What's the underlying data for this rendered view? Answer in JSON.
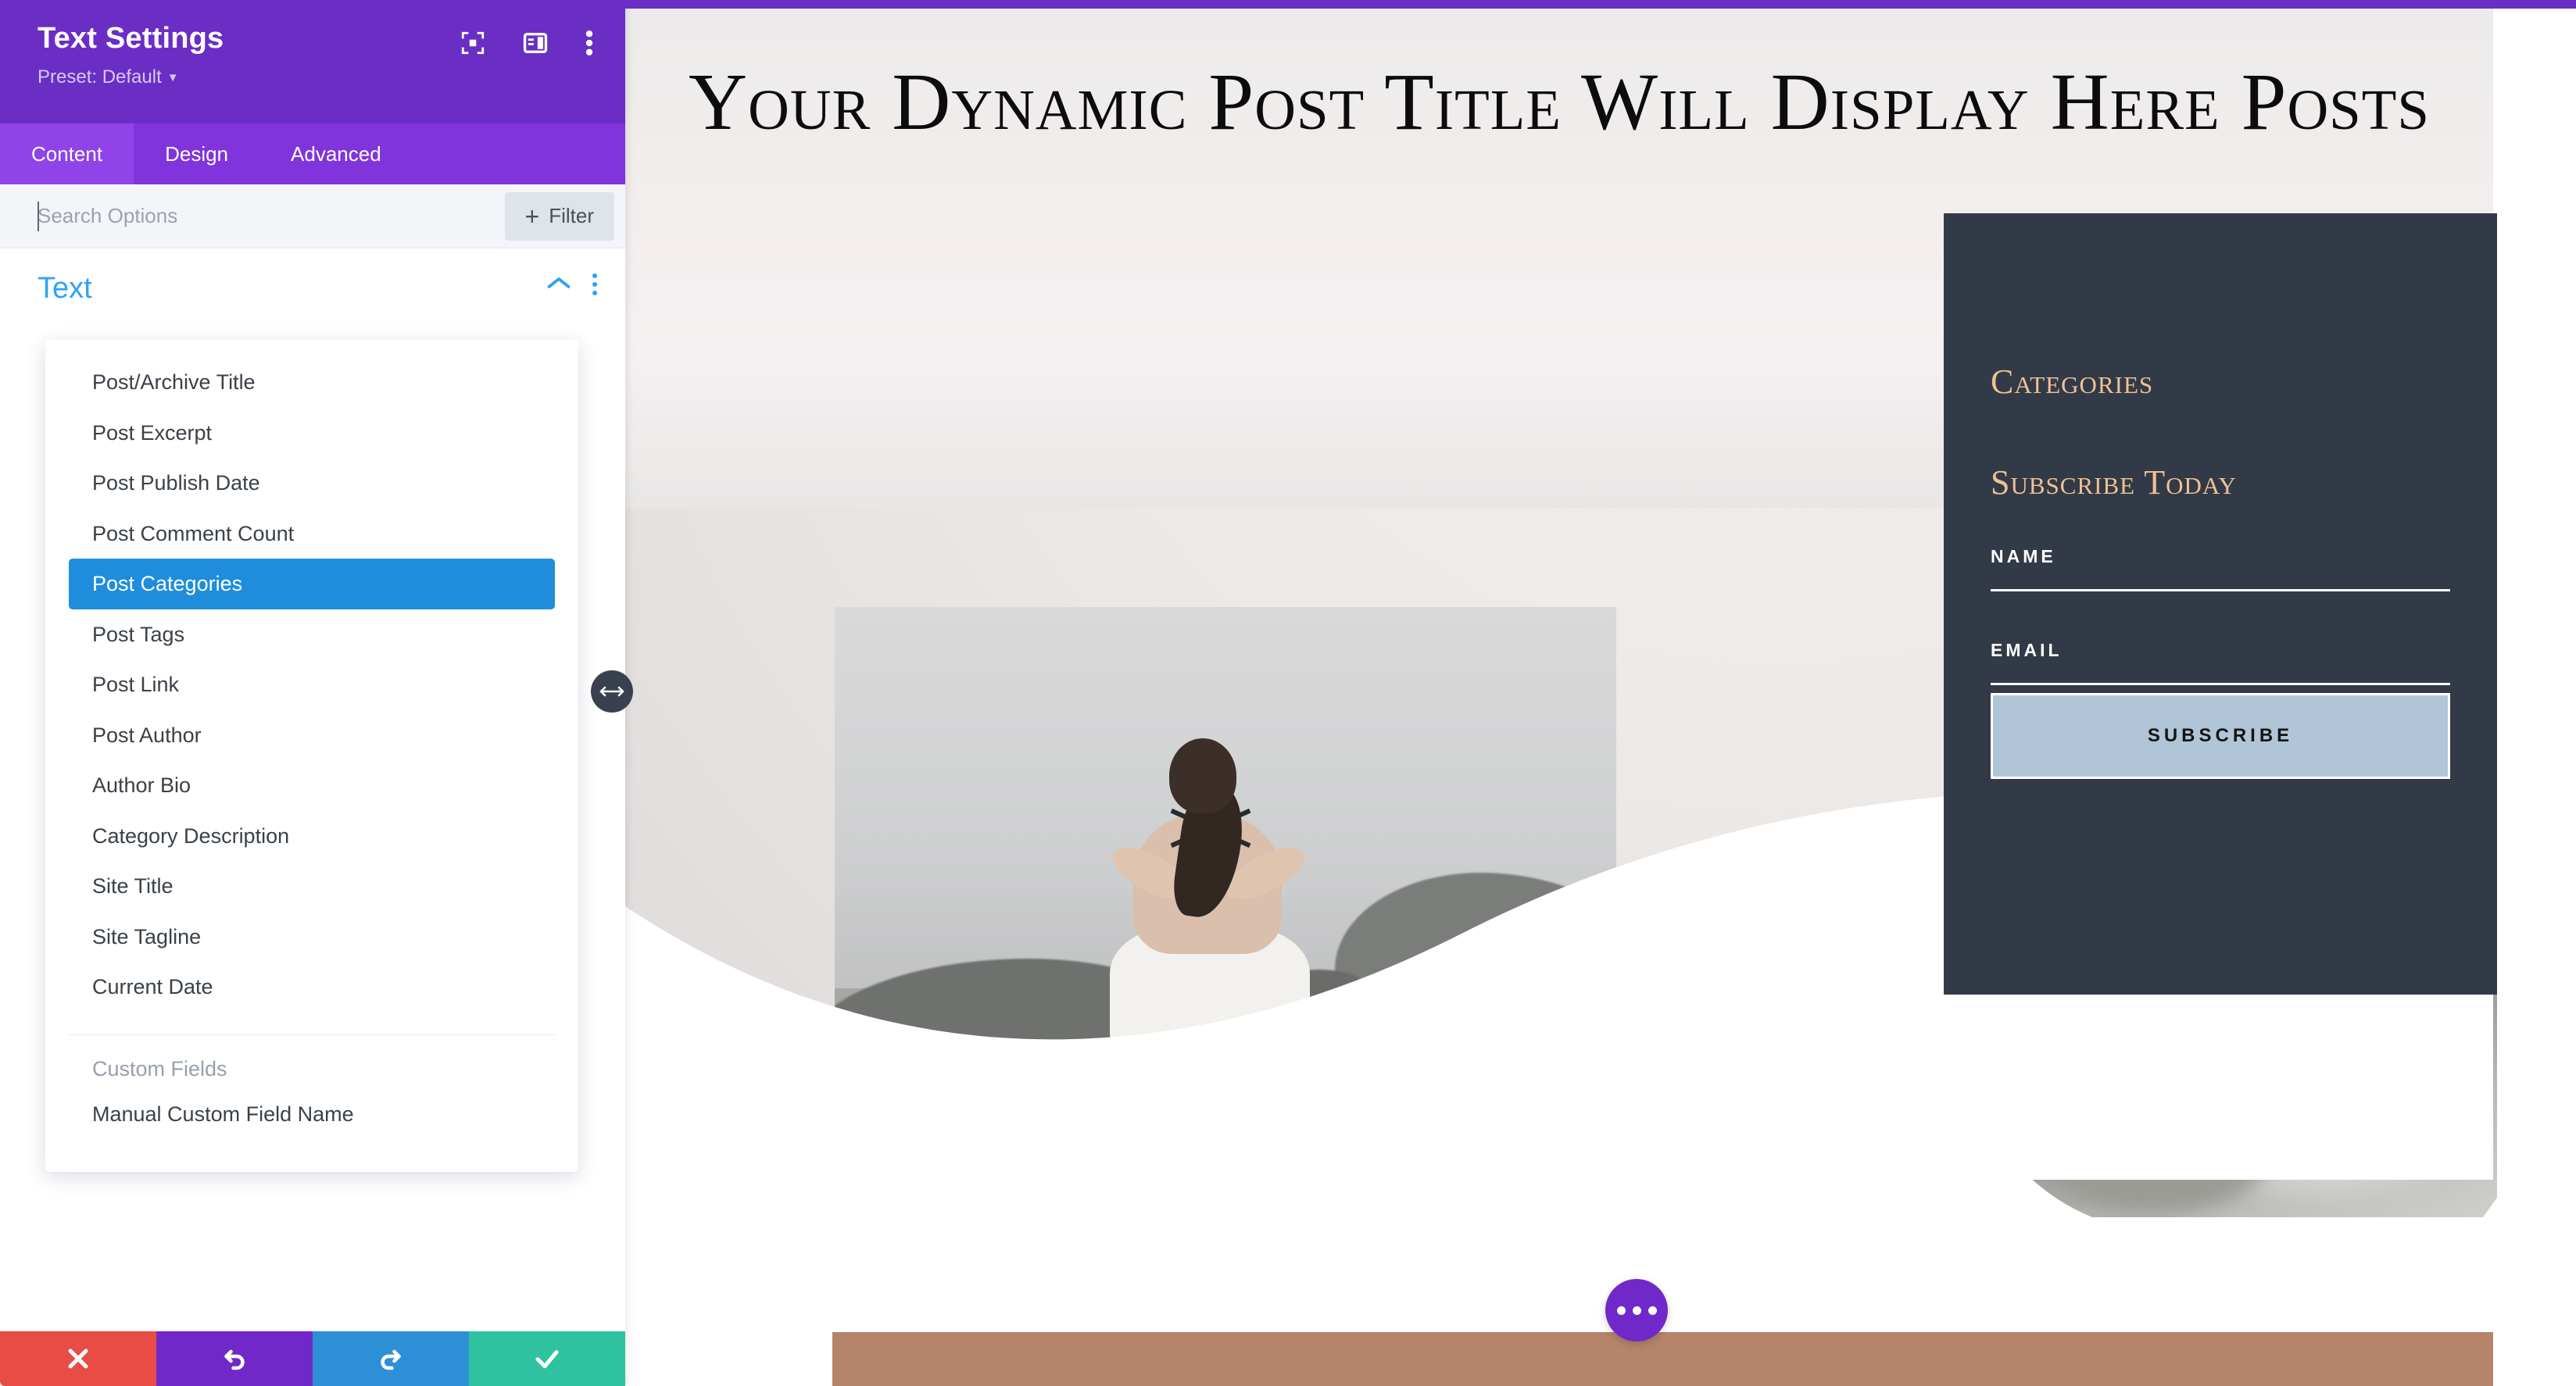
{
  "panel": {
    "title": "Text Settings",
    "preset": "Preset: Default",
    "header_icons": [
      {
        "name": "focus-icon",
        "label": "Focus"
      },
      {
        "name": "layout-panel-icon",
        "label": "Layout"
      },
      {
        "name": "more-options-icon",
        "label": "More Options"
      }
    ],
    "tabs": [
      {
        "label": "Content",
        "active": true
      },
      {
        "label": "Design",
        "active": false
      },
      {
        "label": "Advanced",
        "active": false
      }
    ],
    "search": {
      "placeholder": "Search Options",
      "value": ""
    },
    "filter_button": {
      "label": "Filter",
      "plus": "+"
    },
    "section": {
      "title": "Text",
      "collapse_icon": "chevron-up-icon",
      "menu_icon": "kebab-menu-icon"
    },
    "dropdown": {
      "items": [
        "Post/Archive Title",
        "Post Excerpt",
        "Post Publish Date",
        "Post Comment Count",
        "Post Categories",
        "Post Tags",
        "Post Link",
        "Post Author",
        "Author Bio",
        "Category Description",
        "Site Title",
        "Site Tagline",
        "Current Date"
      ],
      "selected": "Post Categories",
      "group_label": "Custom Fields",
      "custom_items": [
        "Manual Custom Field Name"
      ]
    },
    "actions": [
      {
        "name": "cancel-button",
        "icon": "close-icon",
        "color": "#e74c45"
      },
      {
        "name": "undo-button",
        "icon": "undo-icon",
        "color": "#7128c8"
      },
      {
        "name": "redo-button",
        "icon": "redo-icon",
        "color": "#2d8fd5"
      },
      {
        "name": "save-button",
        "icon": "check-icon",
        "color": "#2fc2a0"
      }
    ],
    "resize_handle": "resize-horizontal-icon"
  },
  "canvas": {
    "hero_title": "Your Dynamic Post Title Will Display Here Posts",
    "sidebar_card": {
      "categories_heading": "Categories",
      "subscribe_heading": "Subscribe Today",
      "name_label": "NAME",
      "email_label": "EMAIL",
      "subscribe_button": "SUBSCRIBE"
    },
    "fab": {
      "name": "page-settings-fab",
      "icon": "ellipsis-icon"
    }
  },
  "colors": {
    "brand_purple": "#6a2ec4",
    "tab_purple": "#8134db",
    "accent_blue": "#2ea3f2",
    "selected_blue": "#1f8ddb",
    "dark_card": "#333a47",
    "gold": "#eec294",
    "subscribe_bg": "#b0c6d8",
    "brown_band": "#b5846a",
    "cancel_red": "#e74c45",
    "redo_blue": "#2d8fd5",
    "save_green": "#2fc2a0"
  }
}
